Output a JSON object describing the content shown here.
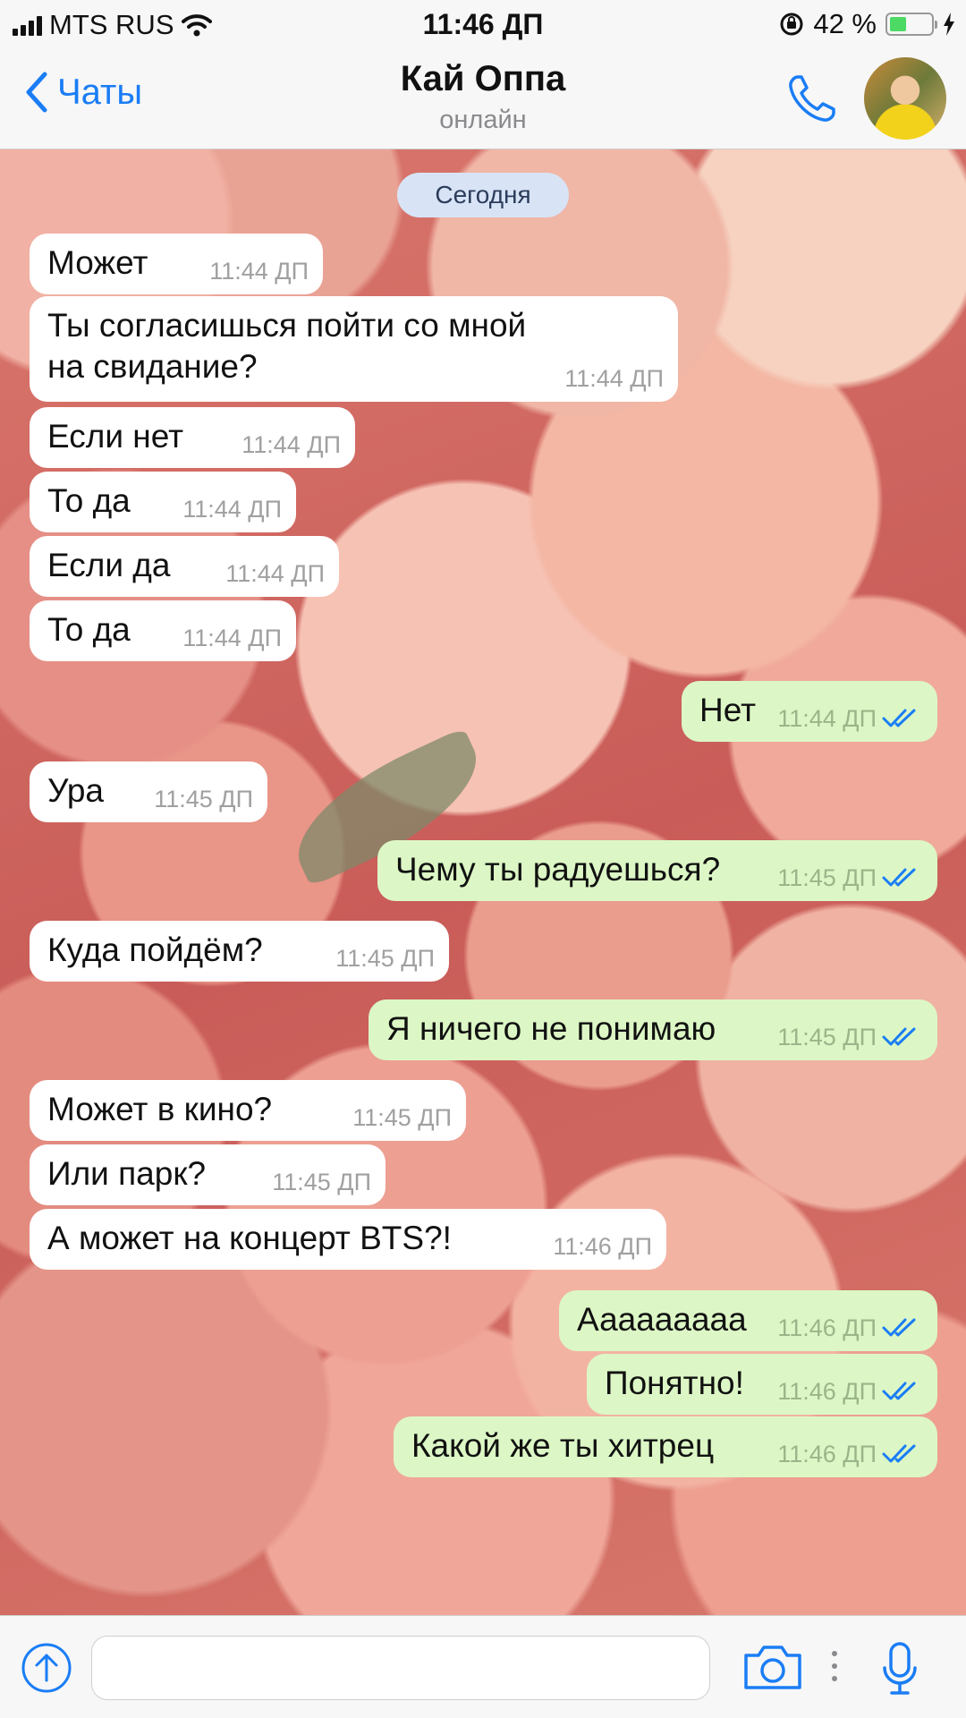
{
  "status_bar": {
    "carrier": "MTS RUS",
    "time": "11:46 ДП",
    "battery_percent": "42 %",
    "battery_level": 0.42
  },
  "header": {
    "back_label": "Чаты",
    "contact_name": "Кай Оппа",
    "contact_status": "онлайн"
  },
  "chat": {
    "date_label": "Сегодня",
    "messages": [
      {
        "dir": "in",
        "text": "Может",
        "time": "11:44 ДП"
      },
      {
        "dir": "in",
        "text": "Ты согласишься пойти со мной на свидание?",
        "time": "11:44 ДП"
      },
      {
        "dir": "in",
        "text": "Если нет",
        "time": "11:44 ДП"
      },
      {
        "dir": "in",
        "text": "То да",
        "time": "11:44 ДП"
      },
      {
        "dir": "in",
        "text": "Если да",
        "time": "11:44 ДП"
      },
      {
        "dir": "in",
        "text": "То да",
        "time": "11:44 ДП"
      },
      {
        "dir": "out",
        "text": "Нет",
        "time": "11:44 ДП",
        "status": "read"
      },
      {
        "dir": "in",
        "text": "Ура",
        "time": "11:45 ДП"
      },
      {
        "dir": "out",
        "text": "Чему ты радуешься?",
        "time": "11:45 ДП",
        "status": "read"
      },
      {
        "dir": "in",
        "text": "Куда пойдём?",
        "time": "11:45 ДП"
      },
      {
        "dir": "out",
        "text": "Я ничего не понимаю",
        "time": "11:45 ДП",
        "status": "read"
      },
      {
        "dir": "in",
        "text": "Может в кино?",
        "time": "11:45 ДП"
      },
      {
        "dir": "in",
        "text": "Или парк?",
        "time": "11:45 ДП"
      },
      {
        "dir": "in",
        "text": "А может на концерт BTS?!",
        "time": "11:46 ДП"
      },
      {
        "dir": "out",
        "text": "Ааааааааа",
        "time": "11:46 ДП",
        "status": "read"
      },
      {
        "dir": "out",
        "text": "Понятно!",
        "time": "11:46 ДП",
        "status": "read"
      },
      {
        "dir": "out",
        "text": "Какой же ты хитрец",
        "time": "11:46 ДП",
        "status": "read"
      }
    ]
  },
  "input": {
    "value": "",
    "placeholder": ""
  },
  "icons": {
    "back": "chevron-left-icon",
    "call": "phone-icon",
    "attach": "upload-arrow-icon",
    "camera": "camera-icon",
    "more": "more-vertical-icon",
    "mic": "microphone-icon",
    "read_receipt": "double-check-icon"
  },
  "colors": {
    "accent": "#1a7df5",
    "outgoing_bubble": "#dcf7c5",
    "incoming_bubble": "#ffffff",
    "date_chip": "#d8e4f6",
    "read_ticks": "#1a7df5",
    "battery": "#4cd964"
  }
}
